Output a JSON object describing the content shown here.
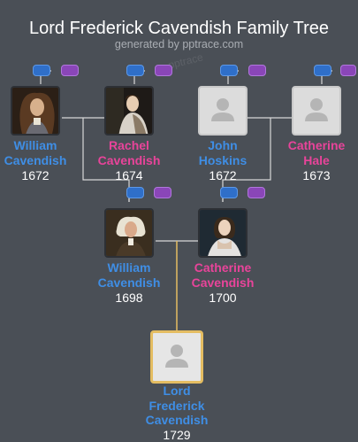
{
  "header": {
    "title": "Lord Frederick Cavendish Family Tree",
    "subtitle": "generated by pptrace.com",
    "watermark": "pptrace"
  },
  "colors": {
    "background": "#4a4f56",
    "male": "#3f8ee5",
    "female": "#e8449a",
    "line": "#d8d8d8",
    "focus_line": "#e4bd62"
  },
  "people": {
    "william_gp": {
      "first": "William",
      "last": "Cavendish",
      "year": "1672",
      "photo": "portrait"
    },
    "rachel": {
      "first": "Rachel",
      "last": "Cavendish",
      "year": "1674",
      "photo": "portrait"
    },
    "john": {
      "first": "John",
      "last": "Hoskins",
      "year": "1672",
      "photo": "placeholder-icon"
    },
    "catherine_hale": {
      "first": "Catherine",
      "last": "Hale",
      "year": "1673",
      "photo": "placeholder-icon"
    },
    "william_father": {
      "first": "William",
      "last": "Cavendish",
      "year": "1698",
      "photo": "portrait"
    },
    "catherine_mother": {
      "first": "Catherine",
      "last": "Cavendish",
      "year": "1700",
      "photo": "portrait"
    },
    "frederick": {
      "line1": "Lord",
      "line2": "Frederick",
      "line3": "Cavendish",
      "year": "1729",
      "photo": "placeholder-icon"
    }
  }
}
